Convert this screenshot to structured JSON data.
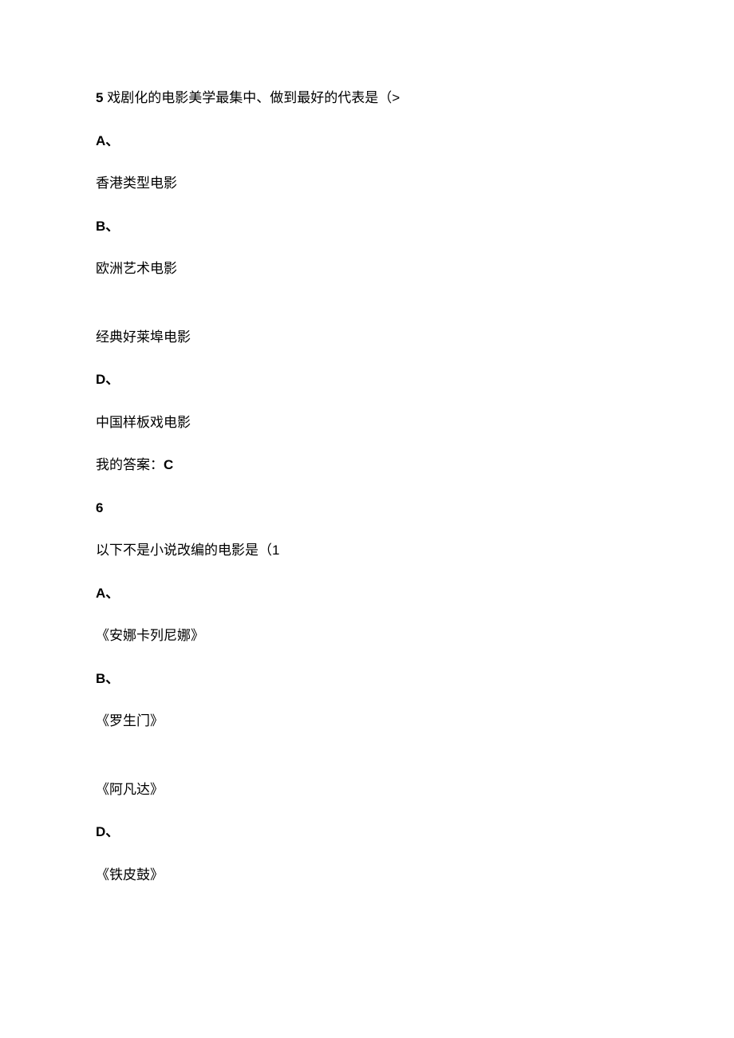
{
  "q5": {
    "number_prefix": "5",
    "stem_text": " 戏剧化的电影美学最集中、做到最好的代表是（>",
    "options": {
      "A": {
        "label": "A、",
        "text": "香港类型电影"
      },
      "B": {
        "label": "B、",
        "text": "欧洲艺术电影"
      },
      "C": {
        "text": "经典好莱埠电影"
      },
      "D": {
        "label": "D、",
        "text": "中国样板戏电影"
      }
    },
    "answer_label": "我的答案：",
    "answer_value": "C"
  },
  "q6": {
    "number": "6",
    "stem_text": "以下不是小说改编的电影是（1",
    "options": {
      "A": {
        "label": "A、",
        "text": "《安娜卡列尼娜》"
      },
      "B": {
        "label": "B、",
        "text": "《罗生门》"
      },
      "C": {
        "text": "《阿凡达》"
      },
      "D": {
        "label": "D、",
        "text": "《铁皮鼓》"
      }
    }
  }
}
